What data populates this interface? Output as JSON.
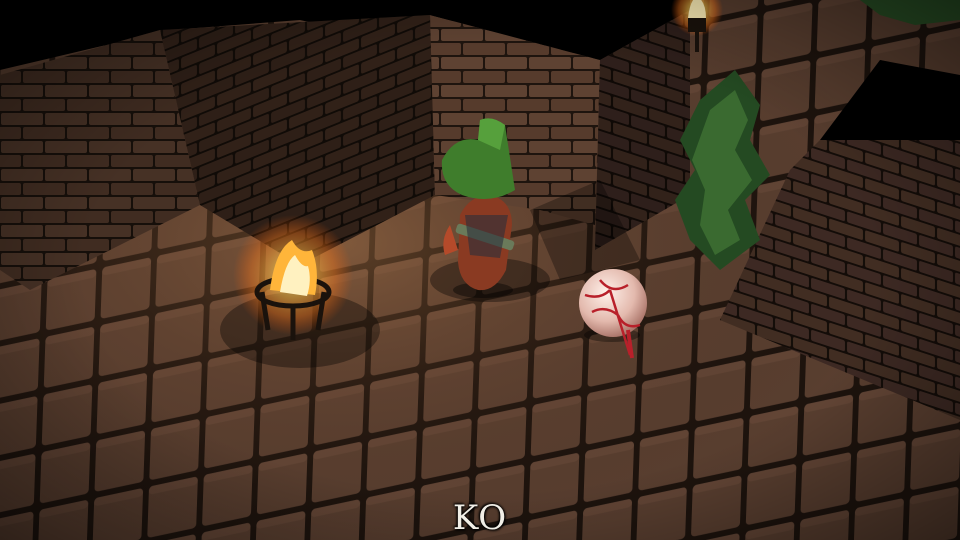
{
  "hud": {
    "status_text": "KO"
  },
  "palette": {
    "floor_tile": "#5a3f30",
    "grout": "#1d130d",
    "wall_brick": "#5e4232",
    "wall_shadow": "#2c1e16",
    "void": "#000000",
    "fire_core": "#fff6cf",
    "fire_outer": "#ff9a2a",
    "foliage": "#2f5a2a",
    "hero_hat": "#3f7d2c",
    "eyeball": "#e8c8c0",
    "vein": "#b8202a"
  },
  "scene": {
    "elements": [
      "brick-walls",
      "stone-floor",
      "fire-brazier",
      "wall-torch",
      "player-character",
      "eyeball-monster",
      "bush-foliage"
    ]
  }
}
